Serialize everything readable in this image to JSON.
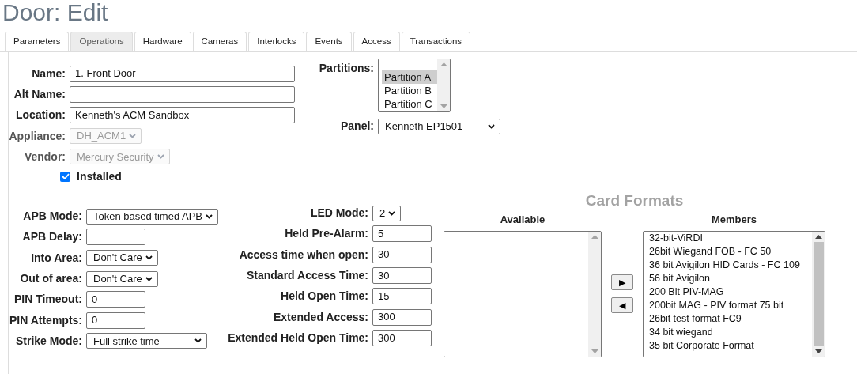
{
  "title": "Door: Edit",
  "tabs": [
    {
      "label": "Parameters",
      "selected": false
    },
    {
      "label": "Operations",
      "selected": true
    },
    {
      "label": "Hardware",
      "selected": false
    },
    {
      "label": "Cameras",
      "selected": false
    },
    {
      "label": "Interlocks",
      "selected": false
    },
    {
      "label": "Events",
      "selected": false
    },
    {
      "label": "Access",
      "selected": false
    },
    {
      "label": "Transactions",
      "selected": false
    }
  ],
  "general": [
    {
      "label": "Name:",
      "kind": "text",
      "value": "1. Front Door",
      "disabled": false
    },
    {
      "label": "Alt Name:",
      "kind": "text",
      "disabled": false
    },
    {
      "label": "Location:",
      "kind": "text",
      "value": "Kenneth's ACM Sandbox",
      "disabled": false
    },
    {
      "label": "Appliance:",
      "kind": "select",
      "value": "DH_ACM1",
      "disabled": true
    },
    {
      "label": "Vendor:",
      "kind": "select",
      "value": "Mercury Security",
      "disabled": true
    }
  ],
  "installed": {
    "label": "Installed",
    "checked": true
  },
  "partitions": {
    "label": "Partitions:",
    "options": [
      {
        "label": "Partition A",
        "selected": true
      },
      {
        "label": "Partition B",
        "selected": false
      },
      {
        "label": "Partition C",
        "selected": false
      }
    ]
  },
  "panel": {
    "label": "Panel:",
    "value": "Kenneth EP1501"
  },
  "apb": [
    {
      "label": "APB Mode:",
      "kind": "select",
      "value": "Token based timed APB"
    },
    {
      "label": "APB Delay:",
      "kind": "text"
    },
    {
      "label": "Into Area:",
      "kind": "select",
      "value": "Don't Care"
    },
    {
      "label": "Out of area:",
      "kind": "select",
      "value": "Don't Care"
    },
    {
      "label": "PIN Timeout:",
      "kind": "text",
      "value": "0"
    },
    {
      "label": "PIN Attempts:",
      "kind": "text",
      "value": "0"
    },
    {
      "label": "Strike Mode:",
      "kind": "select",
      "value": "Full strike time"
    }
  ],
  "timing": [
    {
      "label": "LED Mode:",
      "kind": "select",
      "value": "2"
    },
    {
      "label": "Held Pre-Alarm:",
      "kind": "text",
      "value": "5"
    },
    {
      "label": "Access time when open:",
      "kind": "text",
      "value": "30"
    },
    {
      "label": "Standard Access Time:",
      "kind": "text",
      "value": "30"
    },
    {
      "label": "Held Open Time:",
      "kind": "text",
      "value": "15"
    },
    {
      "label": "Extended Access:",
      "kind": "text",
      "value": "300"
    },
    {
      "label": "Extended Held Open Time:",
      "kind": "text",
      "value": "300"
    }
  ],
  "card_formats": {
    "title": "Card Formats",
    "available_label": "Available",
    "members_label": "Members",
    "add_button": "▶",
    "remove_button": "◀",
    "members": [
      "32-bit-ViRDI",
      "26bit Wiegand FOB - FC 50",
      "36 bit Avigilon HID Cards - FC 109",
      "56 bit Avigilon",
      "200 Bit PIV-MAG",
      "200bit MAG - PIV format 75 bit",
      "26bit test format FC9",
      "34 bit wiegand",
      "35 bit Corporate Format"
    ]
  }
}
